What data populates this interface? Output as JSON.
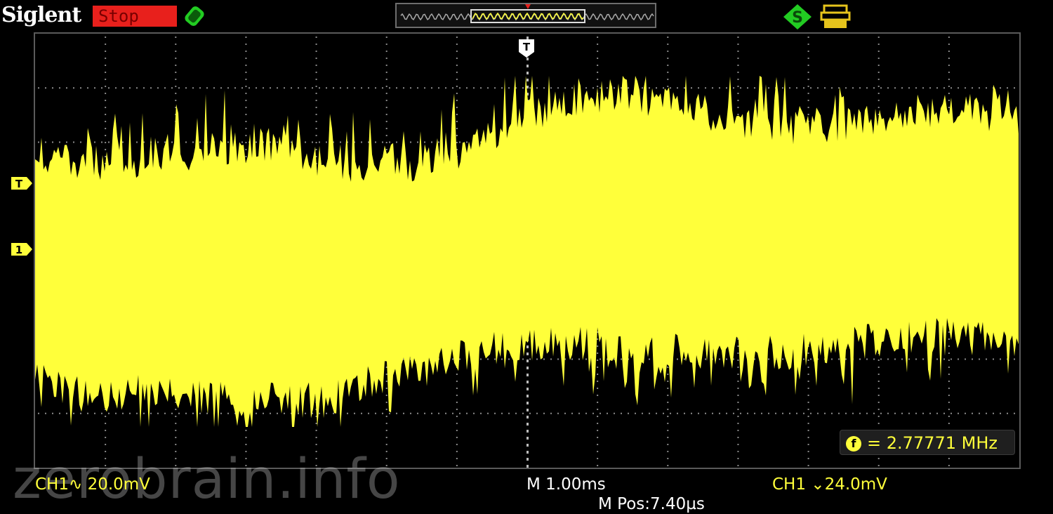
{
  "header": {
    "brand": "Siglent",
    "run_status": "Stop"
  },
  "icons": {
    "probe": "probe-icon",
    "memory": "memory-depth-icon",
    "trigger_status": "trigger-status-icon",
    "usb": "usb-storage-icon"
  },
  "markers": {
    "trigger_position": "T",
    "trigger_level": "T",
    "channel1": "1"
  },
  "measurement": {
    "icon_label": "f",
    "frequency": "= 2.77771 MHz"
  },
  "status": {
    "ch1_scale": "CH1∿ 20.0mV",
    "timebase": "M 1.00ms",
    "mpos": "M Pos:7.40µs",
    "trigger": "CH1 ⌄24.0mV"
  },
  "watermark": "zerobrain.info",
  "colors": {
    "trace": "#ffff3a",
    "run_status_bg": "#e8201c",
    "grid": "#7a7a7a",
    "icon_green": "#22cc22"
  }
}
